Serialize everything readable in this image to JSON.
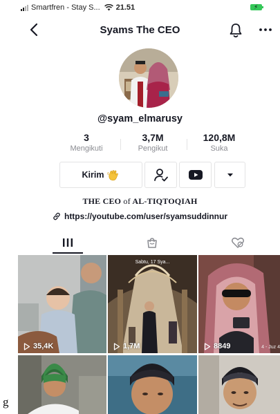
{
  "status_bar": {
    "carrier": "Smartfren - Stay S...",
    "time": "21.51"
  },
  "header": {
    "title": "Syams The CEO"
  },
  "profile": {
    "username": "@syam_elmarusy",
    "stats": [
      {
        "value": "3",
        "label": "Mengikuti"
      },
      {
        "value": "3,7M",
        "label": "Pengikut"
      },
      {
        "value": "120,8M",
        "label": "Suka"
      }
    ],
    "message_button_label": "Kirim",
    "bio_prefix": "THE CEO",
    "bio_mid": "of",
    "bio_suffix": "AL-TIQTOQIAH",
    "link": "https://youtube.com/user/syamsuddinnur"
  },
  "grid": {
    "videos": [
      {
        "views": "35,4K"
      },
      {
        "views": "1,7M",
        "caption": "Sabtu, 17 Sya..."
      },
      {
        "views": "8849",
        "date": "4 - Juz 4"
      },
      {
        "views": ""
      },
      {
        "views": ""
      },
      {
        "views": ""
      }
    ]
  },
  "stray_text": "g"
}
